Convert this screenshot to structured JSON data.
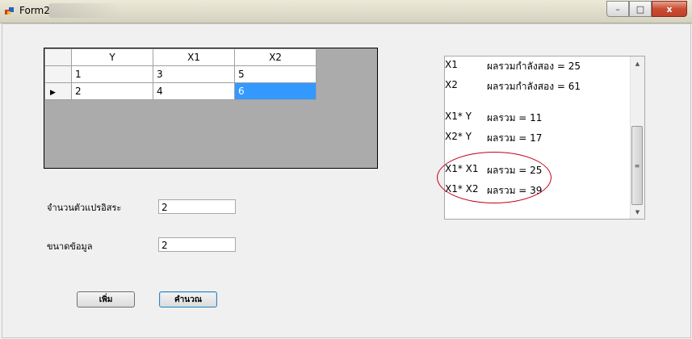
{
  "window": {
    "title": "Form2",
    "min": "–",
    "max": "□",
    "close": "x"
  },
  "grid": {
    "columns": [
      "Y",
      "X1",
      "X2"
    ],
    "rows": [
      {
        "marker": "",
        "cells": [
          "1",
          "3",
          "5"
        ]
      },
      {
        "marker": "▶",
        "cells": [
          "2",
          "4",
          "6"
        ]
      }
    ]
  },
  "form": {
    "var_count_label": "จำนวนตัวแปรอิสระ",
    "var_count_value": "2",
    "data_size_label": "ขนาดข้อมูล",
    "data_size_value": "2"
  },
  "buttons": {
    "add": "เพิ่ม",
    "calculate": "คำนวณ"
  },
  "results": [
    {
      "key": "X1",
      "value": "ผลรวมกำลังสอง = 25"
    },
    {
      "key": "X2",
      "value": "ผลรวมกำลังสอง = 61"
    },
    {
      "key": "X1* Y",
      "value": "ผลรวม  = 11"
    },
    {
      "key": "X2* Y",
      "value": "ผลรวม  = 17"
    },
    {
      "key": "X1* X1",
      "value": "ผลรวม   = 25"
    },
    {
      "key": "X1* X2",
      "value": "ผลรวม   = 39"
    }
  ],
  "colors": {
    "highlight_ellipse": "#c4001a",
    "selected_cell": "#3399ff"
  }
}
